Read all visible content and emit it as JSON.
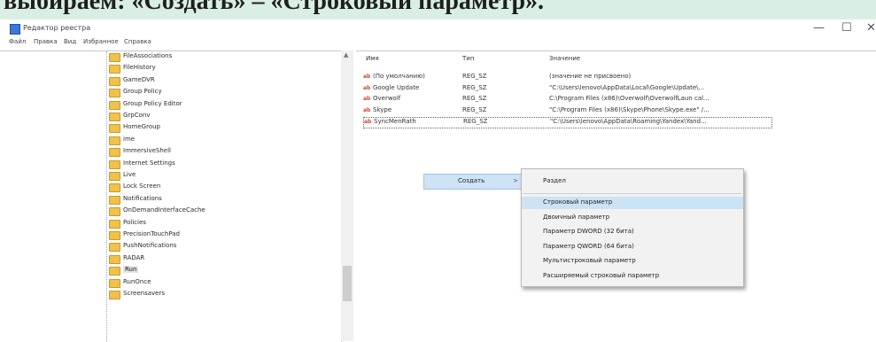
{
  "caption": "выбираем: «Создать» – «Строковый параметр».",
  "window": {
    "title": "Редактор реестра",
    "minimize": "—",
    "maximize": "☐",
    "close": "✕"
  },
  "menu": [
    "Файл",
    "Правка",
    "Вид",
    "Избранное",
    "Справка"
  ],
  "tree": [
    "FileAssociations",
    "FileHistory",
    "GameDVR",
    "Group Policy",
    "Group Policy Editor",
    "GrpConv",
    "HomeGroup",
    "ime",
    "ImmersiveShell",
    "Internet Settings",
    "Live",
    "Lock Screen",
    "Notifications",
    "OnDemandInterfaceCache",
    "Policies",
    "PrecisionTouchPad",
    "PushNotifications",
    "RADAR",
    "Run",
    "RunOnce",
    "Screensavers"
  ],
  "selected_tree_index": 18,
  "values": {
    "headers": [
      "Имя",
      "Тип",
      "Значение"
    ],
    "rows": [
      {
        "name": "(По умолчанию)",
        "type": "REG_SZ",
        "data": "(значение не присвоено)"
      },
      {
        "name": "Google Update",
        "type": "REG_SZ",
        "data": "\"C:\\Users\\lenovo\\AppData\\Local\\Google\\Update\\..."
      },
      {
        "name": "Overwolf",
        "type": "REG_SZ",
        "data": "C:\\Program Files (x86)\\Overwolf\\OverwolfLaun cal..."
      },
      {
        "name": "Skype",
        "type": "REG_SZ",
        "data": "\"C:\\Program Files (x86)\\Skype\\Phone\\Skype.exe\" /..."
      },
      {
        "name": "SyncMenRath",
        "type": "REG_SZ",
        "data": "\"C:\\Users\\lenovo\\AppData\\Roaming\\Yandex\\Yand..."
      }
    ]
  },
  "context": {
    "create_label": "Создать",
    "create_arrow": ">",
    "items": [
      "Раздел",
      "Строковый параметр",
      "Двоичный параметр",
      "Параметр DWORD (32 бита)",
      "Параметр QWORD (64 бита)",
      "Мультистроковый параметр",
      "Расширяемый строковый параметр"
    ],
    "highlighted_index": 1
  },
  "colors": {
    "folder": "#f0c24b",
    "highlight": "#cce3f6",
    "caption_bg": "#d9efe3"
  },
  "icons": {
    "app": "registry-icon",
    "value": "ab-string-icon",
    "folder": "folder-icon"
  }
}
